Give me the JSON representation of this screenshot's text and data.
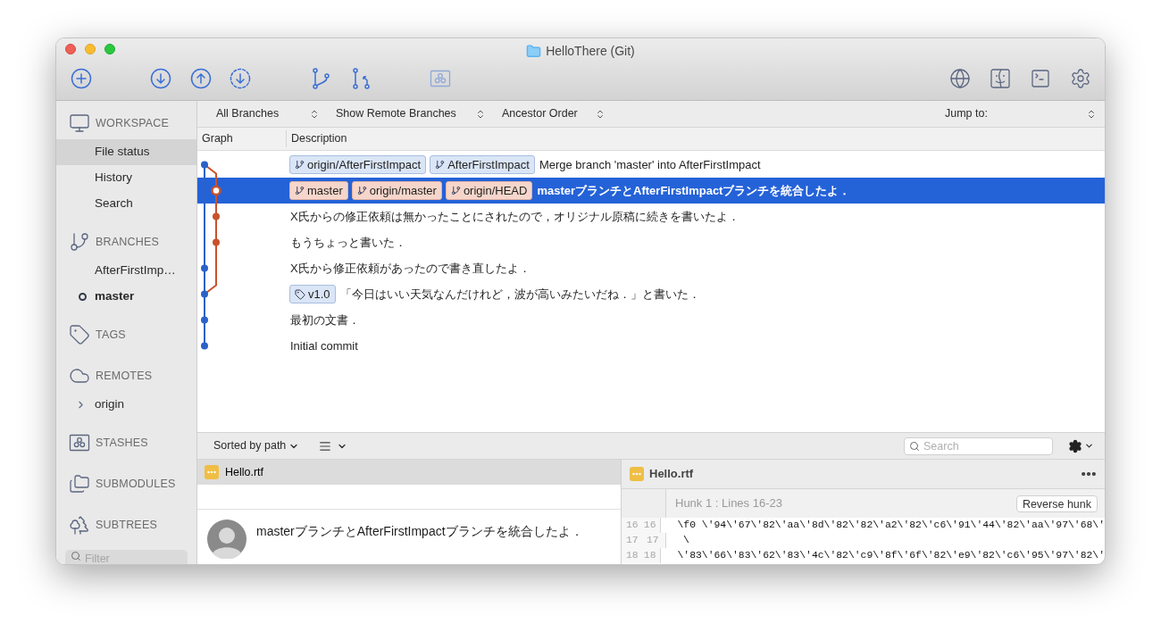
{
  "window": {
    "title": "HelloThere (Git)"
  },
  "sidebar": {
    "sections": [
      {
        "kind": "workspace",
        "label": "WORKSPACE",
        "items": [
          {
            "label": "File status",
            "selected": true
          },
          {
            "label": "History",
            "selected": false
          },
          {
            "label": "Search",
            "selected": false
          }
        ]
      },
      {
        "kind": "branches",
        "label": "BRANCHES",
        "items": [
          {
            "label": "AfterFirstImp…",
            "current": false
          },
          {
            "label": "master",
            "current": true
          }
        ]
      },
      {
        "kind": "tags",
        "label": "TAGS"
      },
      {
        "kind": "remotes",
        "label": "REMOTES",
        "items": [
          {
            "label": "origin",
            "expanded": false
          }
        ]
      },
      {
        "kind": "stashes",
        "label": "STASHES"
      },
      {
        "kind": "submodules",
        "label": "SUBMODULES"
      },
      {
        "kind": "subtrees",
        "label": "SUBTREES"
      }
    ],
    "filter": {
      "placeholder": "Filter"
    }
  },
  "log_filters": [
    {
      "label": "All Branches"
    },
    {
      "label": "Show Remote Branches"
    },
    {
      "label": "Ancestor Order"
    }
  ],
  "jump_to": {
    "label": "Jump to:"
  },
  "columns": [
    "Graph",
    "Description"
  ],
  "commits": [
    {
      "kind": "mainline",
      "selected": false,
      "refs": [
        {
          "kind": "branch",
          "label": "origin/AfterFirstImpact",
          "head": false
        },
        {
          "kind": "branch",
          "label": "AfterFirstImpact",
          "head": false
        }
      ],
      "message": "Merge branch 'master' into AfterFirstImpact"
    },
    {
      "kind": "side",
      "selected": true,
      "refs": [
        {
          "kind": "branch",
          "label": "master",
          "head": true
        },
        {
          "kind": "branch",
          "label": "origin/master",
          "head": true
        },
        {
          "kind": "branch",
          "label": "origin/HEAD",
          "head": true
        }
      ],
      "message": "masterブランチとAfterFirstImpactブランチを統合したよ．"
    },
    {
      "kind": "side",
      "selected": false,
      "message": "X氏からの修正依頼は無かったことにされたので，オリジナル原稿に続きを書いたよ．"
    },
    {
      "kind": "side",
      "selected": false,
      "message": "もうちょっと書いた．"
    },
    {
      "kind": "mainline",
      "selected": false,
      "message": "X氏から修正依頼があったので書き直したよ．"
    },
    {
      "kind": "mainline",
      "selected": false,
      "refs": [
        {
          "kind": "tag",
          "label": "v1.0",
          "head": false
        }
      ],
      "message": "「今日はいい天気なんだけれど，波が高いみたいだね．」と書いた．"
    },
    {
      "kind": "mainline",
      "selected": false,
      "message": "最初の文書．"
    },
    {
      "kind": "mainline",
      "selected": false,
      "message": "Initial commit"
    }
  ],
  "file_list": {
    "sort": "Sorted by path",
    "search": {
      "placeholder": "Search"
    },
    "files": [
      {
        "name": "Hello.rtf",
        "kind": "modified",
        "selected": true
      }
    ]
  },
  "commit_detail": {
    "message": "masterブランチとAfterFirstImpactブランチを統合したよ．"
  },
  "diff": {
    "file": "Hello.rtf",
    "kind": "modified",
    "hunk": "Hunk 1 : Lines 16-23",
    "action": "Reverse hunk",
    "lines": [
      {
        "old": "16",
        "new": "16",
        "text": "\\f0 \\'94\\'67\\'82\\'aa\\'8d\\'82\\'82\\'a2\\'82\\'c6\\'91\\'44\\'82\\'aa\\'97\\'68\\'"
      },
      {
        "old": "17",
        "new": "17",
        "text": "\\"
      },
      {
        "old": "18",
        "new": "18",
        "text": "\\'83\\'66\\'83\\'62\\'83\\'4c\\'82\\'c9\\'8f\\'6f\\'82\\'e9\\'82\\'c6\\'95\\'97\\'82\\'"
      }
    ]
  }
}
